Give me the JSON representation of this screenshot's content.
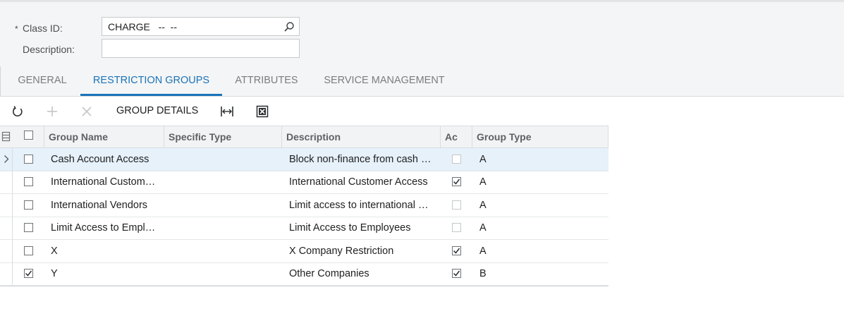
{
  "form": {
    "class_id_label": "Class ID:",
    "class_id_required_mark": "*",
    "class_id_value": "CHARGE   --  --",
    "description_label": "Description:",
    "description_value": ""
  },
  "tabs": [
    {
      "label": "GENERAL",
      "active": false
    },
    {
      "label": "RESTRICTION GROUPS",
      "active": true
    },
    {
      "label": "ATTRIBUTES",
      "active": false
    },
    {
      "label": "SERVICE MANAGEMENT",
      "active": false
    }
  ],
  "toolbar": {
    "refresh_icon": "refresh-icon",
    "add_icon": "plus-icon",
    "delete_icon": "x-icon",
    "group_details_label": "GROUP DETAILS",
    "fit_columns_icon": "fit-columns-icon",
    "export_icon": "excel-export-icon"
  },
  "grid": {
    "columns": [
      "Group Name",
      "Specific Type",
      "Description",
      "Ac",
      "Group Type"
    ],
    "rows": [
      {
        "included": false,
        "group_name": "Cash Account Access",
        "specific_type": "",
        "description": "Block non-finance from cash …",
        "active": false,
        "group_type": "A",
        "selected": true
      },
      {
        "included": false,
        "group_name": "International Custom…",
        "specific_type": "",
        "description": "International Customer Access",
        "active": true,
        "group_type": "A",
        "selected": false
      },
      {
        "included": false,
        "group_name": "International Vendors",
        "specific_type": "",
        "description": "Limit access to international …",
        "active": false,
        "group_type": "A",
        "selected": false
      },
      {
        "included": false,
        "group_name": "Limit Access to Empl…",
        "specific_type": "",
        "description": "Limit Access to Employees",
        "active": false,
        "group_type": "A",
        "selected": false
      },
      {
        "included": false,
        "group_name": "X",
        "specific_type": "",
        "description": "X Company Restriction",
        "active": true,
        "group_type": "A",
        "selected": false
      },
      {
        "included": true,
        "group_name": "Y",
        "specific_type": "",
        "description": "Other Companies",
        "active": true,
        "group_type": "B",
        "selected": false
      }
    ]
  },
  "colors": {
    "accent": "#1a73b8",
    "selected_row": "#e6f1fa",
    "header_bg": "#f4f5f6"
  }
}
